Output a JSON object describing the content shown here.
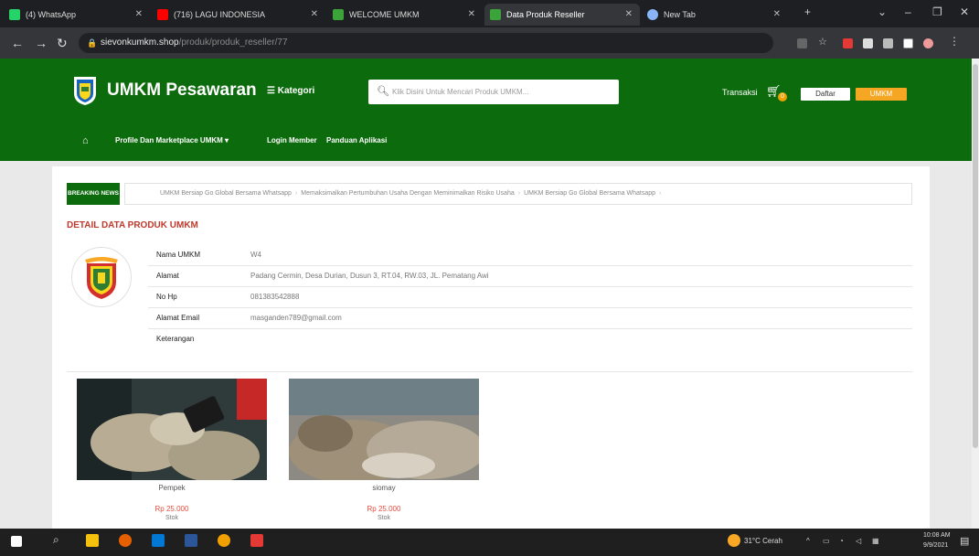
{
  "browser": {
    "tabs": [
      {
        "title": "(4) WhatsApp",
        "color": "#25d366",
        "active": false
      },
      {
        "title": "(716) LAGU INDONESIA",
        "color": "#ff0000",
        "active": false
      },
      {
        "title": "WELCOME UMKM",
        "color": "#3aa33a",
        "active": false
      },
      {
        "title": "Data Produk Reseller",
        "color": "#3aa33a",
        "active": true
      },
      {
        "title": "New Tab",
        "color": "#8ab4f8",
        "active": false
      }
    ],
    "url_host": "sievonkumkm.shop",
    "url_path": "/produk/produk_reseller/77"
  },
  "header": {
    "brand": "UMKM Pesawaran",
    "kategori_label": "Kategori",
    "search_placeholder": "Klik Disini Untuk Mencari Produk UMKM...",
    "transaksi_label": "Transaksi",
    "cart_count": "0",
    "daftar_label": "Daftar",
    "umkm_label": "UMKM"
  },
  "nav": {
    "items": [
      "Profile Dan Marketplace UMKM ▾",
      "Login Member",
      "Panduan Aplikasi"
    ]
  },
  "breaking_news": {
    "label": "BREAKING NEWS",
    "items": [
      "UMKM Bersiap Go Global Bersama Whatsapp",
      "Memaksimalkan Pertumbuhan Usaha Dengan Meminimalkan Risiko Usaha",
      "UMKM Bersiap Go Global Bersama Whatsapp"
    ]
  },
  "detail": {
    "title": "DETAIL DATA PRODUK UMKM",
    "rows": [
      {
        "label": "Nama UMKM",
        "value": "W4"
      },
      {
        "label": "Alamat",
        "value": "Padang Cermin, Desa Durian, Dusun 3, RT.04, RW.03, JL. Pematang Awi"
      },
      {
        "label": "No Hp",
        "value": "081383542888"
      },
      {
        "label": "Alamat Email",
        "value": "masganden789@gmail.com"
      },
      {
        "label": "Keterangan",
        "value": ""
      }
    ]
  },
  "products": [
    {
      "name": "Pempek",
      "price": "Rp 25.000",
      "stock": "Stok"
    },
    {
      "name": "siomay",
      "price": "Rp 25.000",
      "stock": "Stok"
    }
  ],
  "taskbar": {
    "weather": "31°C Cerah",
    "time": "10:08 AM",
    "date": "9/9/2021"
  },
  "colors": {
    "header_green": "#0c6b0c",
    "accent_orange": "#f5a623",
    "price_red": "#e74c3c",
    "title_red": "#c0392b"
  }
}
